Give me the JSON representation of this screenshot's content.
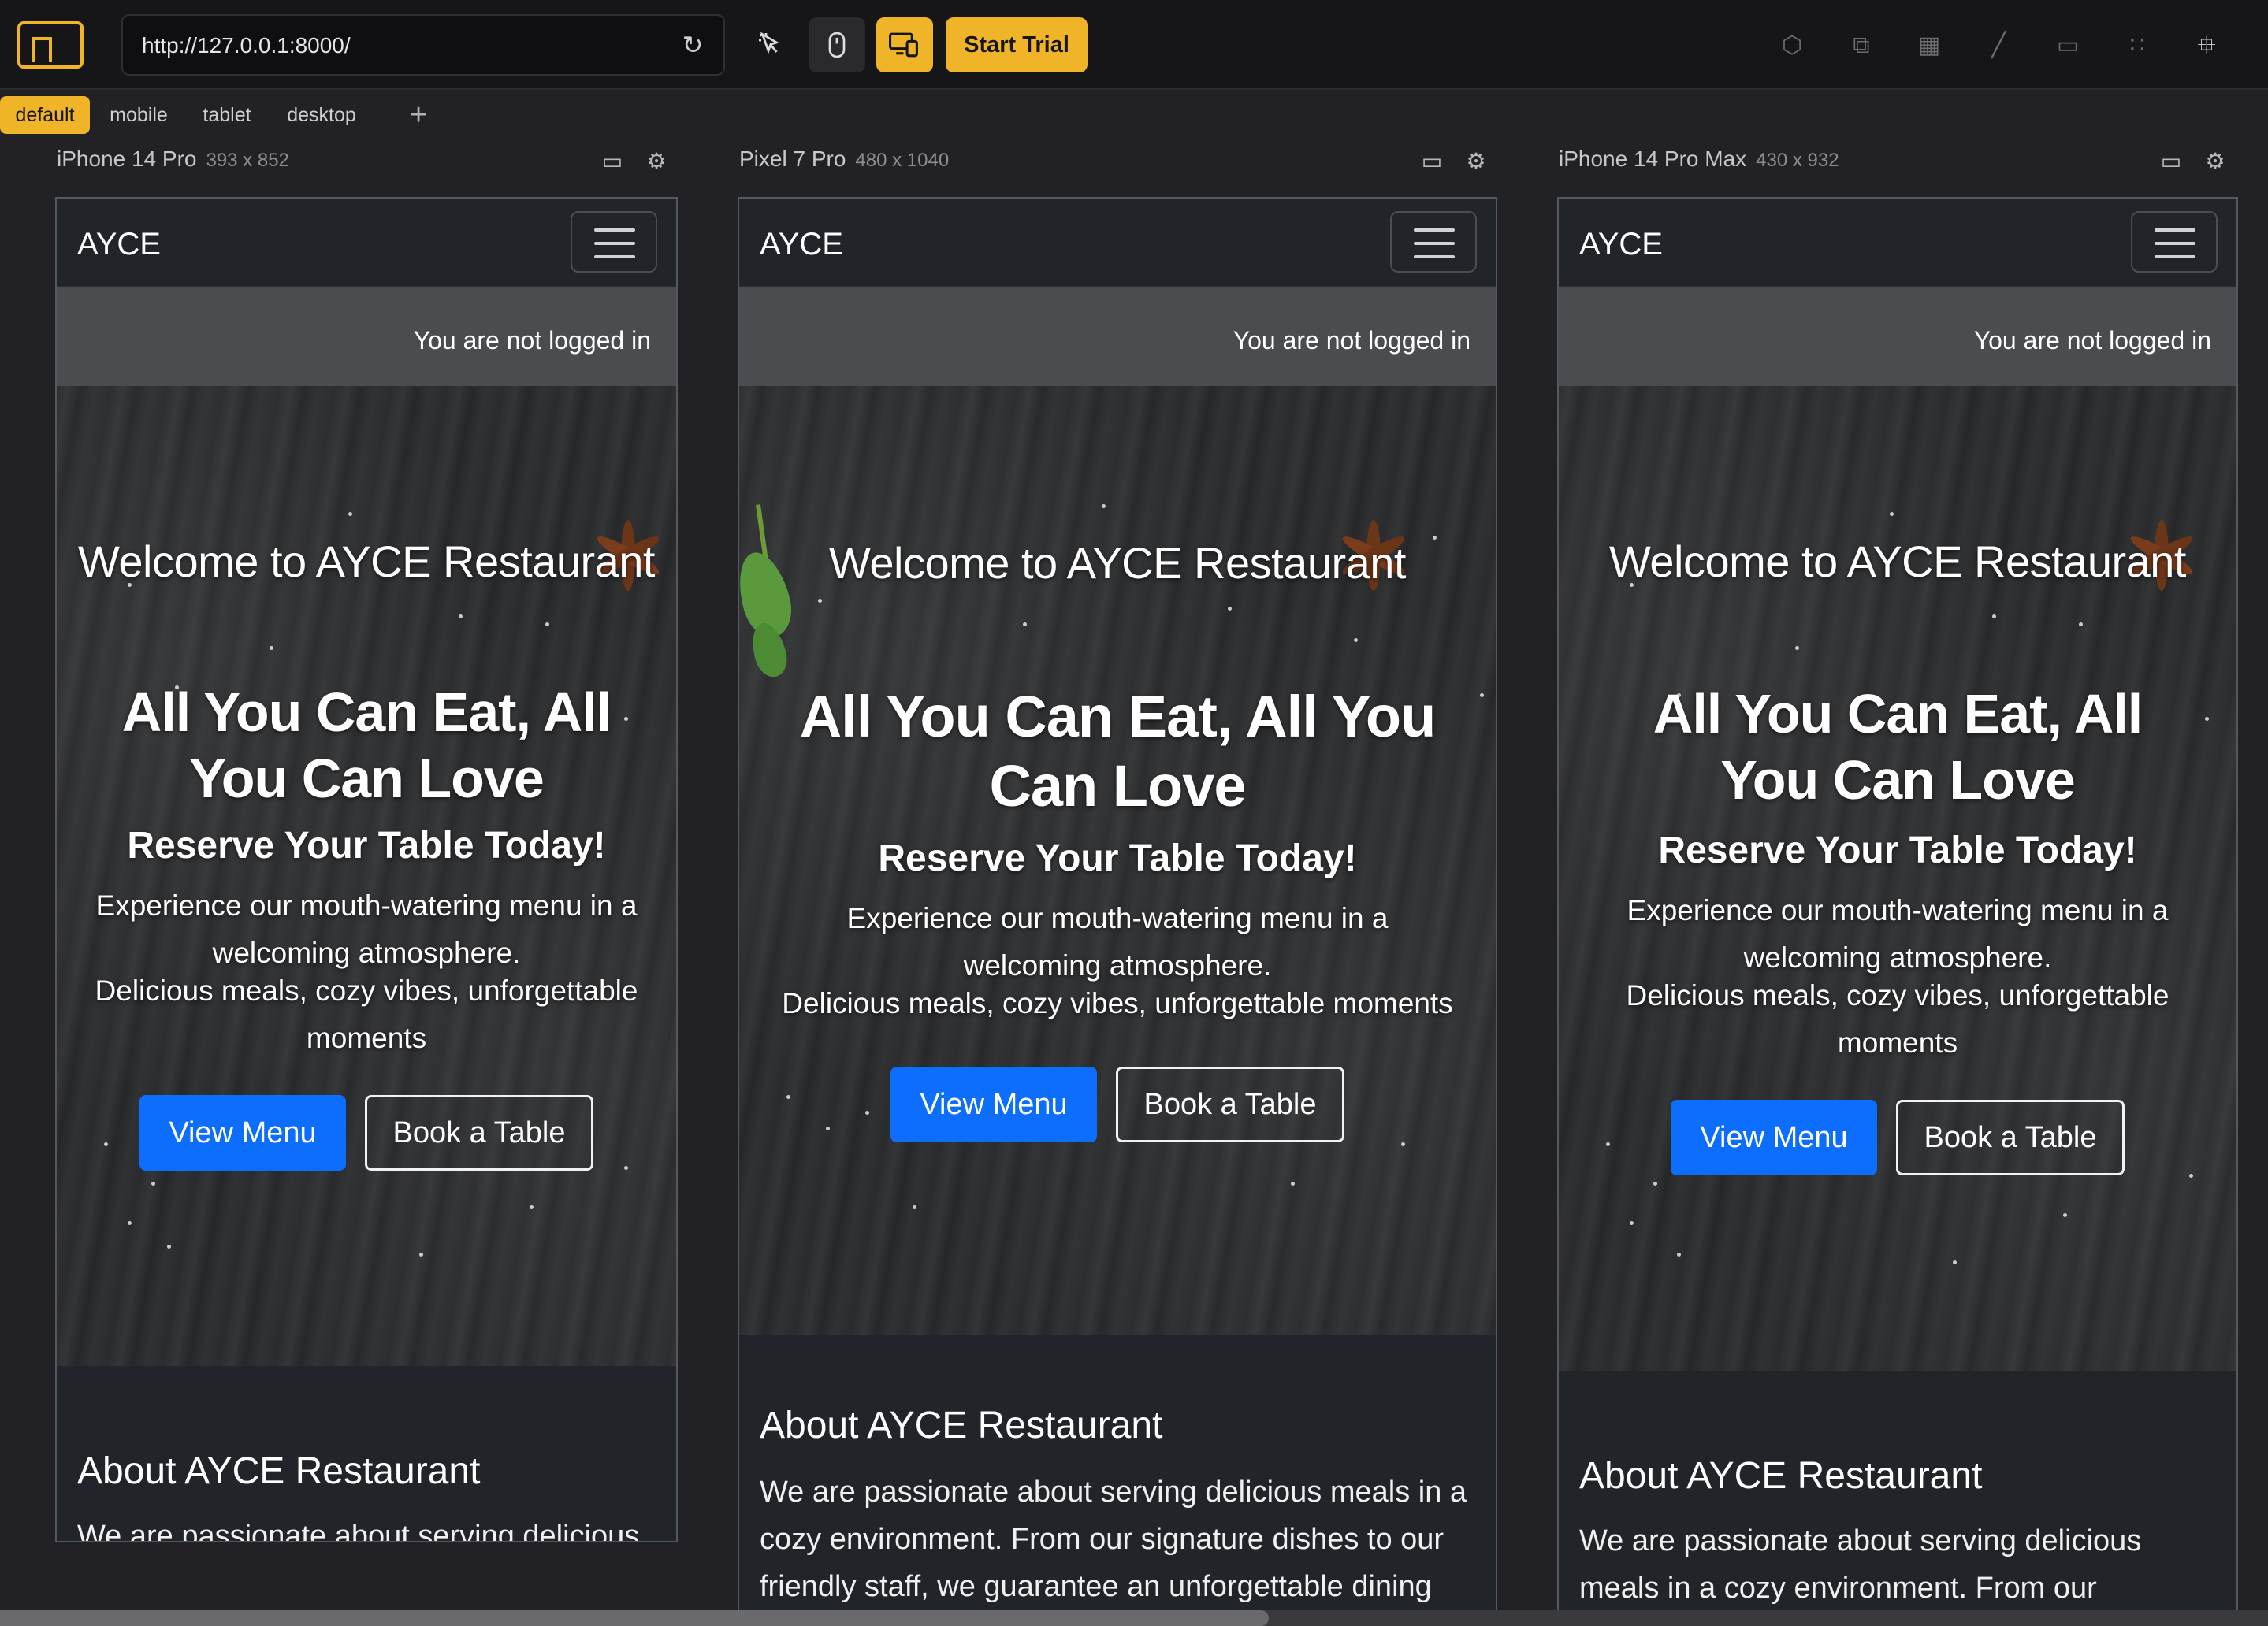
{
  "toolbar": {
    "url": "http://127.0.0.1:8000/",
    "start_trial": "Start Trial",
    "accent": "#f0b429"
  },
  "tabs": [
    {
      "label": "default",
      "active": true
    },
    {
      "label": "mobile",
      "active": false
    },
    {
      "label": "tablet",
      "active": false
    },
    {
      "label": "desktop",
      "active": false
    }
  ],
  "devices": [
    {
      "name": "iPhone 14 Pro",
      "size": "393 x 852"
    },
    {
      "name": "Pixel 7 Pro",
      "size": "480 x 1040"
    },
    {
      "name": "iPhone 14 Pro Max",
      "size": "430 x 932"
    }
  ],
  "site": {
    "brand": "AYCE",
    "status": "You are not logged in",
    "welcome": "Welcome to AYCE Restaurant",
    "headline": "All You Can Eat, All You Can Love",
    "reserve": "Reserve Your Table Today!",
    "tagline": "Experience our mouth-watering menu in a welcoming atmosphere.",
    "vibes": "Delicious meals, cozy vibes, unforgettable moments",
    "view_menu": "View Menu",
    "book_table": "Book a Table",
    "about_title": "About AYCE Restaurant",
    "about_text": "We are passionate about serving delicious meals in a cozy environment. From our signature dishes to our friendly staff, we guarantee an unforgettable dining"
  }
}
